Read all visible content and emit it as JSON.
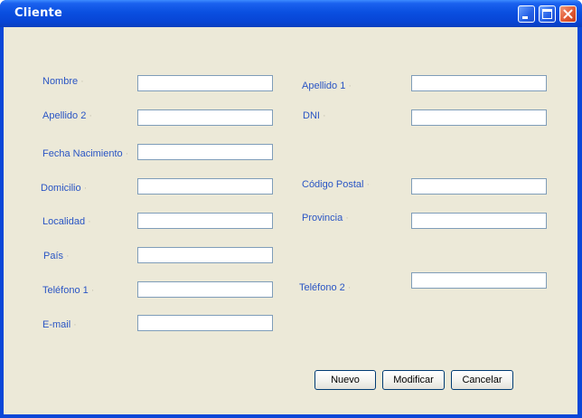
{
  "window": {
    "title": "Cliente"
  },
  "form": {
    "nombre": {
      "label": "Nombre",
      "value": ""
    },
    "apellido1": {
      "label": "Apellido 1",
      "value": ""
    },
    "apellido2": {
      "label": "Apellido 2",
      "value": ""
    },
    "dni": {
      "label": "DNI",
      "value": ""
    },
    "fecha_nacimiento": {
      "label": "Fecha Nacimiento",
      "value": ""
    },
    "domicilio": {
      "label": "Domicilio",
      "value": ""
    },
    "codigo_postal": {
      "label": "Código Postal",
      "value": ""
    },
    "localidad": {
      "label": "Localidad",
      "value": ""
    },
    "provincia": {
      "label": "Provincia",
      "value": ""
    },
    "pais": {
      "label": "País",
      "value": ""
    },
    "telefono1": {
      "label": "Teléfono 1",
      "value": ""
    },
    "telefono2": {
      "label": "Teléfono 2",
      "value": ""
    },
    "email": {
      "label": "E-mail",
      "value": ""
    }
  },
  "buttons": {
    "nuevo": "Nuevo",
    "modificar": "Modificar",
    "cancelar": "Cancelar"
  }
}
